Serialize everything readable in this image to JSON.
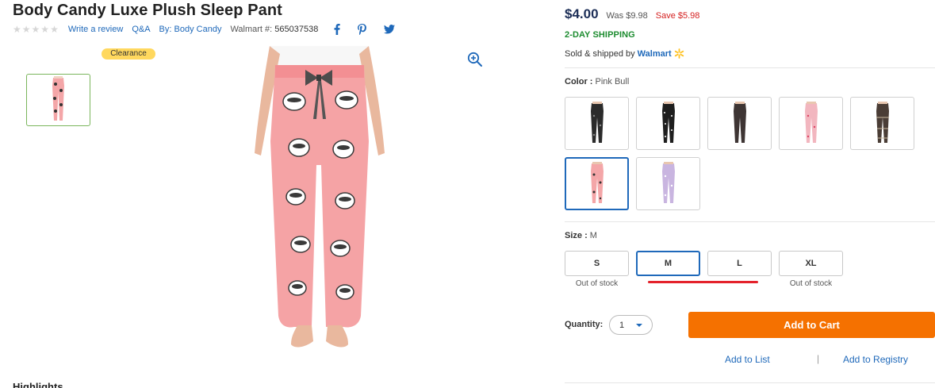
{
  "product": {
    "title": "Body Candy Luxe Plush Sleep Pant",
    "write_review": "Write a review",
    "qa": "Q&A",
    "by_label": "By:",
    "brand": "Body Candy",
    "walmart_num_label": "Walmart #:",
    "walmart_num": "565037538",
    "rating_stars": 0,
    "badge": "Clearance",
    "highlights_heading": "Highlights"
  },
  "social": {
    "facebook": "facebook-icon",
    "pinterest": "pinterest-icon",
    "twitter": "twitter-icon"
  },
  "pricing": {
    "price": "$4.00",
    "was": "Was $9.98",
    "save": "Save $5.98",
    "shipping": "2-DAY SHIPPING",
    "sold_by": "Sold & shipped by",
    "seller": "Walmart"
  },
  "color": {
    "label": "Color :",
    "selected": "Pink Bull",
    "swatches": [
      "black-dark",
      "black-white-dot",
      "charcoal",
      "pink-print",
      "black-plaid",
      "pink-bull",
      "lavender"
    ]
  },
  "size": {
    "label": "Size :",
    "selected": "M",
    "options": [
      {
        "label": "S",
        "note": "Out of stock"
      },
      {
        "label": "M",
        "note": ""
      },
      {
        "label": "L",
        "note": ""
      },
      {
        "label": "XL",
        "note": "Out of stock"
      }
    ]
  },
  "quantity": {
    "label": "Quantity:",
    "value": "1"
  },
  "actions": {
    "add_to_cart": "Add to Cart",
    "add_to_list": "Add to List",
    "separator": "|",
    "add_to_registry": "Add to Registry"
  },
  "colors": {
    "link": "#1f69ba",
    "cart_button": "#f57100",
    "save_red": "#d41f1f",
    "shipping_green": "#1b8b2e",
    "clearance_yellow": "#ffd85e",
    "price_navy": "#1c2e57"
  }
}
